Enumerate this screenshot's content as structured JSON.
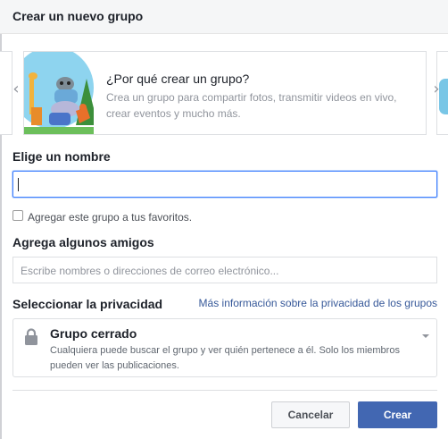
{
  "dialog": {
    "title": "Crear un nuevo grupo"
  },
  "carousel": {
    "card_title": "¿Por qué crear un grupo?",
    "card_description": "Crea un grupo para compartir fotos, transmitir videos en vivo, crear eventos y mucho más."
  },
  "name_section": {
    "label": "Elige un nombre",
    "value": "",
    "favorite_checkbox_label": "Agregar este grupo a tus favoritos.",
    "favorite_checked": false
  },
  "friends_section": {
    "label": "Agrega algunos amigos",
    "placeholder": "Escribe nombres o direcciones de correo electrónico..."
  },
  "privacy_section": {
    "label": "Seleccionar la privacidad",
    "more_info_link": "Más información sobre la privacidad de los grupos",
    "selected_option": "Grupo cerrado",
    "selected_description": "Cualquiera puede buscar el grupo y ver quién pertenece a él. Solo los miembros pueden ver las publicaciones."
  },
  "footer": {
    "cancel_label": "Cancelar",
    "create_label": "Crear"
  },
  "colors": {
    "primary": "#4267b2",
    "link": "#365899",
    "focus_border": "#4080ff"
  }
}
